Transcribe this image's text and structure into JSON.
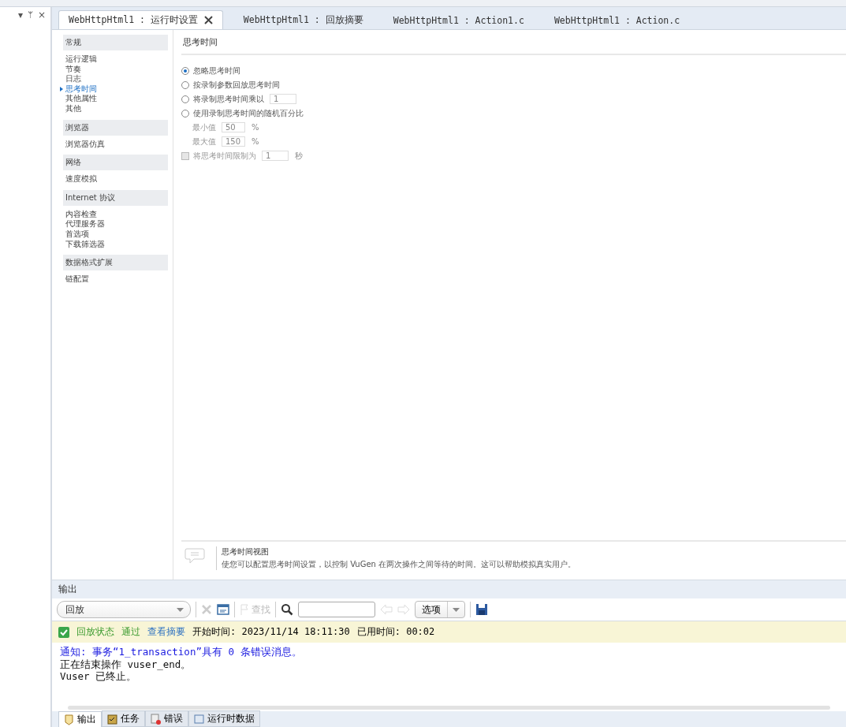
{
  "side_panel": {
    "tools": [
      "▾",
      "ᛘ",
      "×"
    ]
  },
  "tabs": [
    {
      "label": "WebHttpHtml1 : 运行时设置",
      "selected": true,
      "closable": true
    },
    {
      "label": "WebHttpHtml1 : 回放摘要",
      "selected": false,
      "closable": false
    },
    {
      "label": "WebHttpHtml1 : Action1.c",
      "selected": false,
      "closable": false
    },
    {
      "label": "WebHttpHtml1 : Action.c",
      "selected": false,
      "closable": false
    }
  ],
  "nav": [
    {
      "heading": "常规",
      "items": [
        {
          "label": "运行逻辑",
          "selected": false
        },
        {
          "label": "节奏",
          "selected": false
        },
        {
          "label": "日志",
          "selected": false
        },
        {
          "label": "思考时间",
          "selected": true
        },
        {
          "label": "其他属性",
          "selected": false
        },
        {
          "label": "其他",
          "selected": false
        }
      ]
    },
    {
      "heading": "浏览器",
      "items": [
        {
          "label": "浏览器仿真",
          "selected": false
        }
      ]
    },
    {
      "heading": "网络",
      "items": [
        {
          "label": "速度模拟",
          "selected": false
        }
      ]
    },
    {
      "heading": "Internet 协议",
      "items": [
        {
          "label": "内容检查",
          "selected": false
        },
        {
          "label": "代理服务器",
          "selected": false
        },
        {
          "label": "首选项",
          "selected": false
        },
        {
          "label": "下载筛选器",
          "selected": false
        }
      ]
    },
    {
      "heading": "数据格式扩展",
      "items": [
        {
          "label": "链配置",
          "selected": false
        }
      ]
    }
  ],
  "page_title": "思考时间",
  "options": [
    {
      "kind": "radio",
      "label": "忽略思考时间",
      "selected": true,
      "disabled": false
    },
    {
      "kind": "radio",
      "label": "按录制参数回放思考时间",
      "selected": false,
      "disabled": false
    },
    {
      "kind": "radio",
      "label": "将录制思考时间乘以",
      "selected": false,
      "disabled": false,
      "value": "1"
    },
    {
      "kind": "radio",
      "label": "使用录制思考时间的随机百分比",
      "selected": false,
      "disabled": false
    },
    {
      "kind": "sub",
      "label": "最小值",
      "value": "50",
      "unit": "%",
      "disabled": true
    },
    {
      "kind": "sub",
      "label": "最大值",
      "value": "150",
      "unit": "%",
      "disabled": true
    },
    {
      "kind": "checkbox",
      "label": "将思考时间限制为",
      "checked": false,
      "disabled": true,
      "value": "1",
      "unit": "秒"
    }
  ],
  "help": {
    "title": "思考时间视图",
    "text": "使您可以配置思考时间设置，以控制 VuGen 在两次操作之间等待的时间。这可以帮助模拟真实用户。"
  },
  "output": {
    "title": "输出",
    "source": "回放",
    "find": "查找",
    "options": "选项",
    "status": {
      "label": "回放状态",
      "result": "通过",
      "passed": true,
      "link": "查看摘要",
      "start": "开始时间: 2023/11/14 18:11:30",
      "elapsed": "已用时间: 00:02"
    },
    "lines": [
      {
        "kind": "notice",
        "text": "通知: 事务“1_transaction”具有 0 条错误消息。"
      },
      {
        "kind": "plain",
        "text": "正在结束操作 vuser_end。"
      },
      {
        "kind": "plain",
        "text": "Vuser 已终止。"
      }
    ],
    "tabs": [
      {
        "label": "输出",
        "selected": true
      },
      {
        "label": "任务",
        "selected": false
      },
      {
        "label": "错误",
        "selected": false
      },
      {
        "label": "运行时数据",
        "selected": false
      }
    ]
  }
}
